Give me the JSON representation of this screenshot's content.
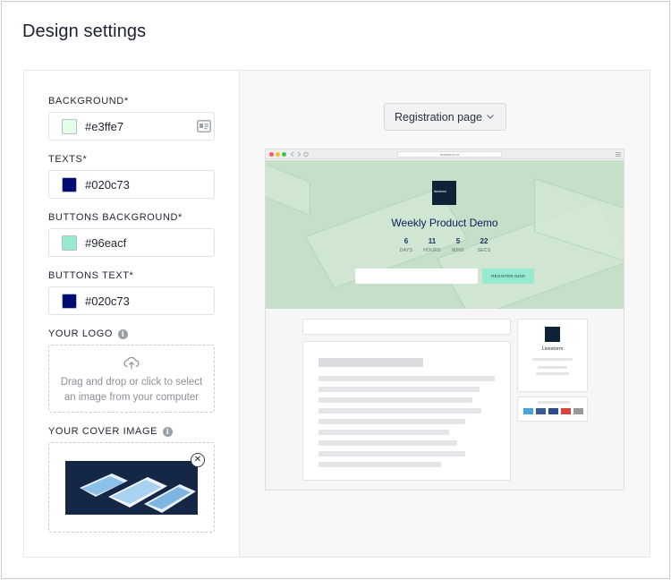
{
  "page": {
    "title": "Design settings"
  },
  "settings": {
    "background": {
      "label": "BACKGROUND*",
      "value": "#e3ffe7"
    },
    "texts": {
      "label": "TEXTS*",
      "value": "#020c73"
    },
    "buttons_background": {
      "label": "BUTTONS BACKGROUND*",
      "value": "#96eacf"
    },
    "buttons_text": {
      "label": "BUTTONS TEXT*",
      "value": "#020c73"
    },
    "logo": {
      "label": "YOUR LOGO",
      "drop_text": "Drag and drop or click to select an image from your computer"
    },
    "cover": {
      "label": "YOUR COVER IMAGE"
    }
  },
  "preview": {
    "page_select": "Registration page",
    "url": "livestorm.co",
    "logo_text": "livestorm",
    "event_title": "Weekly Product Demo",
    "countdown": [
      {
        "value": "6",
        "unit": "DAYS"
      },
      {
        "value": "11",
        "unit": "HOURS"
      },
      {
        "value": "5",
        "unit": "MINS"
      },
      {
        "value": "22",
        "unit": "SECS"
      }
    ],
    "register_label": "REGISTER NOW",
    "organizer_name": "Livestorm"
  },
  "colors": {
    "accent_dark": "#020c73",
    "button_bg": "#96eacf",
    "share_colors": [
      "#4aa3df",
      "#3b5998",
      "#2b4b8c",
      "#d8453b",
      "#9a9a9a"
    ]
  },
  "icons": {
    "picker": "contact-card-icon",
    "info": "info-icon",
    "upload": "upload-cloud-icon",
    "remove": "close-circle-icon",
    "dropdown": "chevron-down-icon"
  }
}
